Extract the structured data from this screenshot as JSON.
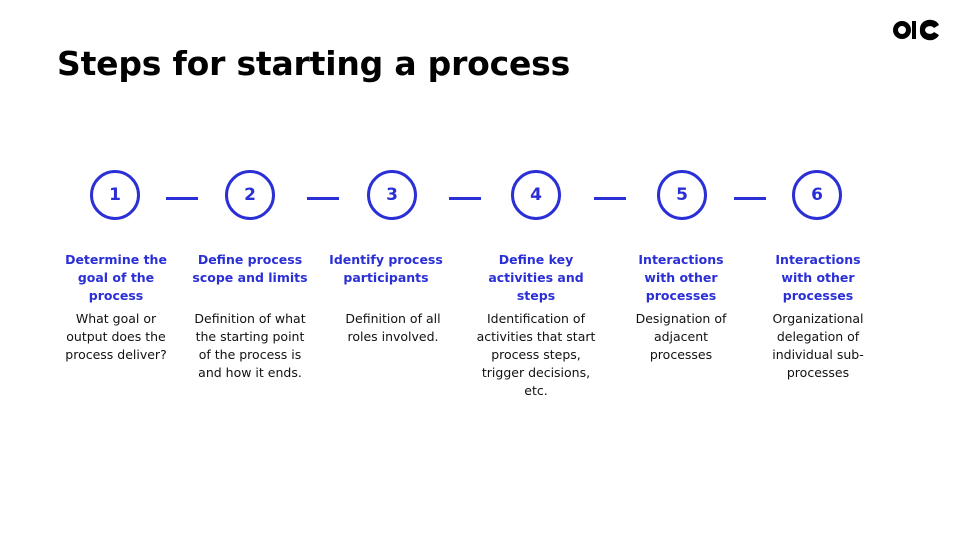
{
  "slide": {
    "title": "Steps for starting a process",
    "logo": "brand-logo",
    "accent_color": "#2b2fd6"
  },
  "steps": [
    {
      "number": "1",
      "title": "Determine the goal of the process",
      "description": "What goal or output does the process deliver?"
    },
    {
      "number": "2",
      "title": "Define process scope and limits",
      "description": "Definition of what the starting point of the process is and how it ends."
    },
    {
      "number": "3",
      "title": "Identify process participants",
      "description": "Definition of all roles involved."
    },
    {
      "number": "4",
      "title": "Define key activities and steps",
      "description": "Identification of activities that start process steps, trigger decisions, etc."
    },
    {
      "number": "5",
      "title": "Interactions with other processes",
      "description": "Designation of adjacent processes"
    },
    {
      "number": "6",
      "title": "Interactions with other processes",
      "description": "Organizational delegation of individual sub-processes"
    }
  ]
}
